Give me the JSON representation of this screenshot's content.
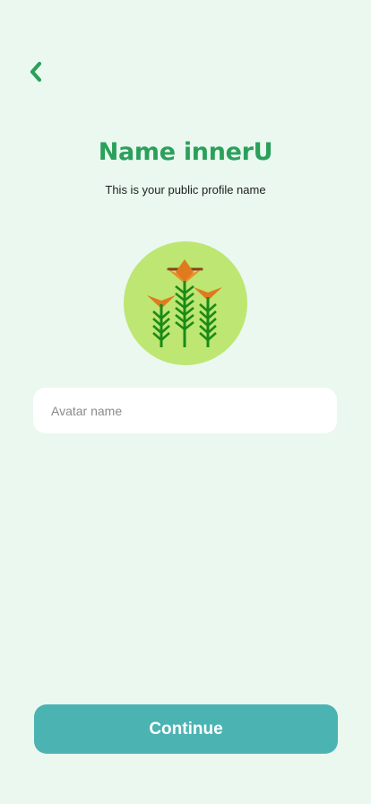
{
  "screen": {
    "background": "#EAF8EF"
  },
  "header": {
    "back_icon": "chevron-left-icon",
    "accent_color": "#2BA05B"
  },
  "main": {
    "title": "Name innerU",
    "subtitle": "This is your public profile name",
    "avatar": {
      "icon": "wheat-plants-icon",
      "background": "#BDE672"
    },
    "name_field": {
      "value": "",
      "placeholder": "Avatar name"
    }
  },
  "footer": {
    "continue_label": "Continue",
    "button_color": "#4CB3B3"
  }
}
